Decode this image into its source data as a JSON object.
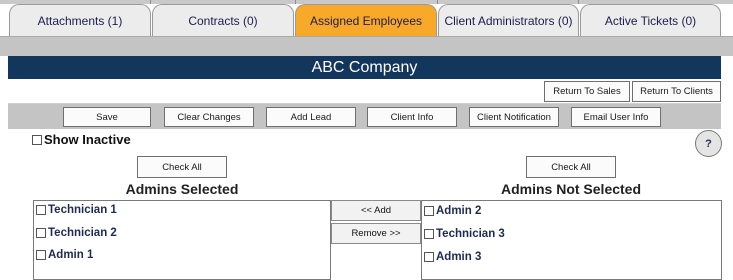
{
  "tabs": [
    {
      "label": "Attachments (1)",
      "active": false
    },
    {
      "label": "Contracts (0)",
      "active": false
    },
    {
      "label": "Assigned Employees",
      "active": true
    },
    {
      "label": "Client Administrators (0)",
      "active": false
    },
    {
      "label": "Active Tickets (0)",
      "active": false
    }
  ],
  "company": {
    "name": "ABC Company"
  },
  "return_buttons": {
    "sales": "Return To Sales",
    "clients": "Return To Clients"
  },
  "toolbar": {
    "save": "Save",
    "clear_changes": "Clear Changes",
    "add_lead": "Add Lead",
    "client_info": "Client Info",
    "client_notification": "Client Notification",
    "email_user_info": "Email User Info"
  },
  "show_inactive": {
    "label": "Show Inactive",
    "checked": false
  },
  "help": {
    "label": "?"
  },
  "left_panel": {
    "check_all": "Check All",
    "heading": "Admins Selected",
    "items": [
      {
        "label": "Technician 1",
        "checked": false
      },
      {
        "label": "Technician 2",
        "checked": false
      },
      {
        "label": "Admin 1",
        "checked": false
      }
    ]
  },
  "right_panel": {
    "check_all": "Check All",
    "heading": "Admins Not Selected",
    "items": [
      {
        "label": "Admin 2",
        "checked": false
      },
      {
        "label": "Technician 3",
        "checked": false
      },
      {
        "label": "Admin 3",
        "checked": false
      }
    ]
  },
  "transfer": {
    "add": "<< Add",
    "remove": "Remove >>"
  },
  "colors": {
    "active_tab": "#f8a92a",
    "header_bar": "#13365c",
    "band": "#c4c4c4"
  }
}
